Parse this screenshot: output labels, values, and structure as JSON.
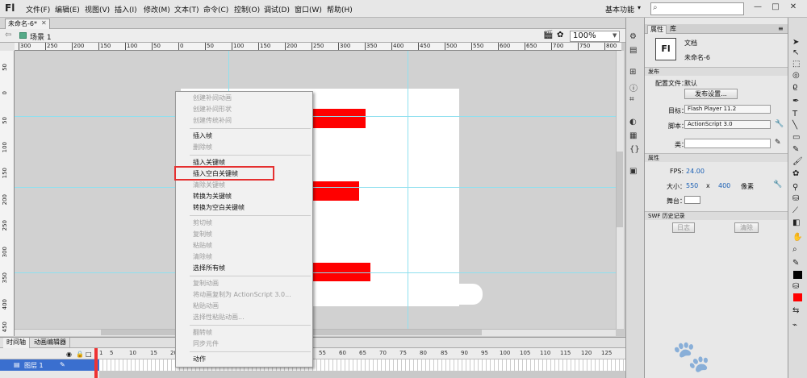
{
  "menubar": {
    "logo": "Fl",
    "items": [
      "文件(F)",
      "编辑(E)",
      "视图(V)",
      "插入(I)",
      "修改(M)",
      "文本(T)",
      "命令(C)",
      "控制(O)",
      "调试(D)",
      "窗口(W)",
      "帮助(H)"
    ],
    "workspace": "基本功能",
    "search_placeholder": "",
    "window_buttons": [
      "—",
      "□",
      "✕"
    ]
  },
  "document": {
    "tab_label": "未命名-6*",
    "close_glyph": "✕"
  },
  "scene": {
    "label": "场景 1",
    "zoom": "100%"
  },
  "rulers": {
    "horizontal": [
      "300",
      "250",
      "200",
      "150",
      "100",
      "50",
      "0",
      "50",
      "100",
      "150",
      "200",
      "250",
      "300",
      "350",
      "400",
      "450",
      "500",
      "550",
      "600",
      "650",
      "700",
      "750",
      "800"
    ],
    "vertical": [
      "50",
      "0",
      "50",
      "100",
      "150",
      "200",
      "250",
      "300",
      "350",
      "400",
      "450"
    ]
  },
  "context_menu": {
    "items": [
      {
        "label": "创建补间动画",
        "enabled": false
      },
      {
        "label": "创建补间形状",
        "enabled": false
      },
      {
        "label": "创建传统补间",
        "enabled": false
      },
      {
        "label": "插入帧",
        "enabled": true
      },
      {
        "label": "删除帧",
        "enabled": false
      },
      {
        "label": "插入关键帧",
        "enabled": true
      },
      {
        "label": "插入空白关键帧",
        "enabled": true
      },
      {
        "label": "清除关键帧",
        "enabled": false
      },
      {
        "label": "转换为关键帧",
        "enabled": true
      },
      {
        "label": "转换为空白关键帧",
        "enabled": true
      },
      {
        "label": "剪切帧",
        "enabled": false
      },
      {
        "label": "复制帧",
        "enabled": false
      },
      {
        "label": "粘贴帧",
        "enabled": false
      },
      {
        "label": "清除帧",
        "enabled": false
      },
      {
        "label": "选择所有帧",
        "enabled": true
      },
      {
        "label": "复制动画",
        "enabled": false
      },
      {
        "label": "将动画复制为 ActionScript 3.0...",
        "enabled": false
      },
      {
        "label": "粘贴动画",
        "enabled": false
      },
      {
        "label": "选择性粘贴动画...",
        "enabled": false
      },
      {
        "label": "翻转帧",
        "enabled": false
      },
      {
        "label": "同步元件",
        "enabled": false
      },
      {
        "label": "动作",
        "enabled": true
      }
    ],
    "highlighted": "插入空白关键帧"
  },
  "timeline": {
    "tabs": [
      "时间轴",
      "动画编辑器"
    ],
    "frame_numbers": [
      "1",
      "5",
      "10",
      "15",
      "20",
      "25",
      "30",
      "35",
      "40",
      "45",
      "50",
      "55",
      "60",
      "65",
      "70",
      "75",
      "80",
      "85",
      "90",
      "95",
      "100",
      "105",
      "110",
      "115",
      "120",
      "125"
    ],
    "layer": "图层 1"
  },
  "properties": {
    "tabs": [
      "属性",
      "库"
    ],
    "doc_icon": "Fl",
    "doc_type": "文档",
    "doc_name": "未命名-6",
    "publish_section": "发布",
    "profile_label": "配置文件：",
    "profile_value": "默认",
    "publish_settings_button": "发布设置...",
    "target_label": "目标：",
    "target_value": "Flash Player 11.2",
    "script_label": "脚本：",
    "script_value": "ActionScript 3.0",
    "class_label": "类：",
    "props_section": "属性",
    "fps_label": "FPS:",
    "fps_value": "24.00",
    "size_label": "大小：",
    "width": "550",
    "size_x": "x",
    "height": "400",
    "size_unit": "像素",
    "stage_label": "舞台：",
    "stage_color": "#ffffff",
    "history_section": "SWF 历史记录",
    "log_button": "日志",
    "clear_button": "清除"
  },
  "colors": {
    "stroke": "#000000",
    "fill": "#ff0000",
    "highlight": "#e53030",
    "layer_selected": "#3a6fcf"
  }
}
